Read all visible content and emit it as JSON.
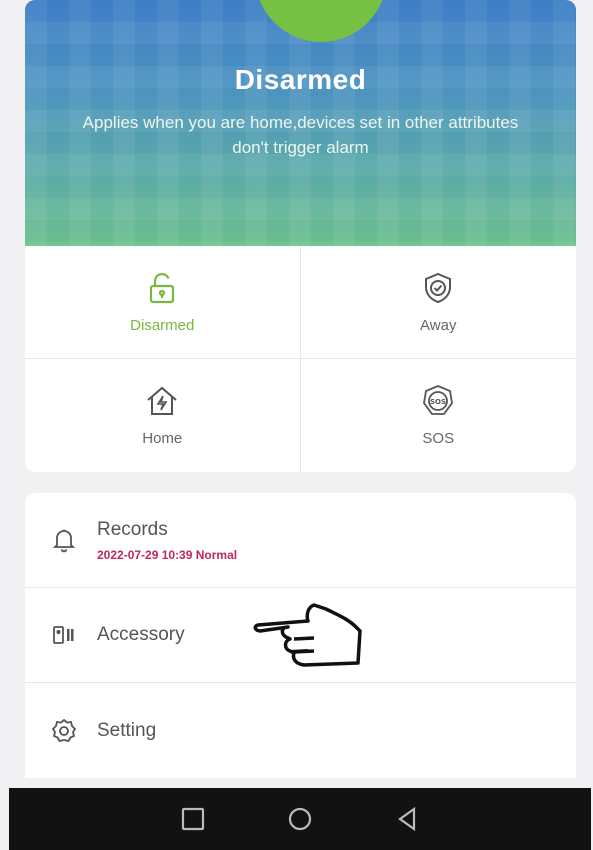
{
  "hero": {
    "title": "Disarmed",
    "description": "Applies when you are home,devices set in other attributes  don't trigger alarm"
  },
  "modes": [
    {
      "label": "Disarmed",
      "icon": "unlock-icon",
      "active": true
    },
    {
      "label": "Away",
      "icon": "shield-check-icon",
      "active": false
    },
    {
      "label": "Home",
      "icon": "home-bolt-icon",
      "active": false
    },
    {
      "label": "SOS",
      "icon": "sos-icon",
      "active": false
    }
  ],
  "list": {
    "records": {
      "label": "Records",
      "sub": "2022-07-29 10:39 Normal",
      "icon": "bell-icon"
    },
    "accessory": {
      "label": "Accessory",
      "icon": "accessory-icon"
    },
    "setting": {
      "label": "Setting",
      "icon": "gear-icon"
    }
  },
  "colors": {
    "active": "#7ab740",
    "record_status": "#c0285a",
    "hero_top": "#3d7ec6",
    "hero_bottom": "#6bbf8c"
  },
  "navbar": [
    "recents-button",
    "home-button",
    "back-button"
  ]
}
